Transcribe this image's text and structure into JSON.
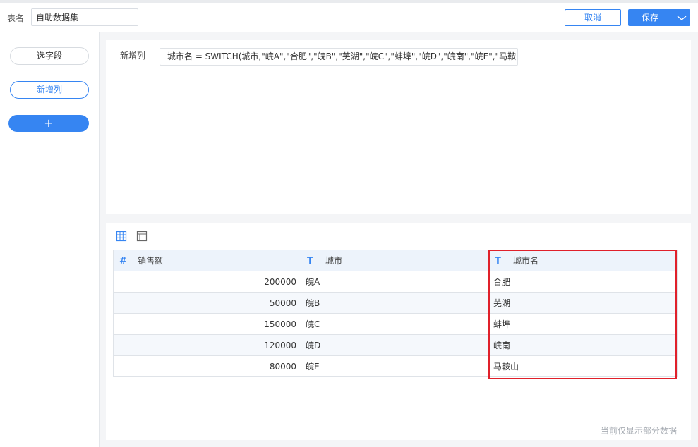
{
  "header": {
    "table_name_label": "表名",
    "table_name_value": "自助数据集",
    "cancel_label": "取消",
    "save_label": "保存"
  },
  "sidebar": {
    "steps": [
      {
        "label": "选字段",
        "active": false
      },
      {
        "label": "新增列",
        "active": true
      }
    ],
    "add_label": "+"
  },
  "formula": {
    "label": "新增列",
    "expression": "城市名 = SWITCH(城市,\"皖A\",\"合肥\",\"皖B\",\"芜湖\",\"皖C\",\"蚌埠\",\"皖D\",\"皖南\",\"皖E\",\"马鞍山\")"
  },
  "preview": {
    "columns": [
      {
        "type_icon": "#",
        "name": "销售额"
      },
      {
        "type_icon": "T",
        "name": "城市"
      },
      {
        "type_icon": "T",
        "name": "城市名"
      }
    ],
    "rows": [
      [
        "200000",
        "皖A",
        "合肥"
      ],
      [
        "50000",
        "皖B",
        "芜湖"
      ],
      [
        "150000",
        "皖C",
        "蚌埠"
      ],
      [
        "120000",
        "皖D",
        "皖南"
      ],
      [
        "80000",
        "皖E",
        "马鞍山"
      ]
    ],
    "footnote": "当前仅显示部分数据"
  },
  "colors": {
    "accent": "#3685f2",
    "highlight": "#e0202a",
    "header_bg": "#edf3fb"
  },
  "icons": [
    "table-view-icon",
    "layout-view-icon",
    "chevron-down-icon",
    "number-type-icon",
    "text-type-icon"
  ]
}
